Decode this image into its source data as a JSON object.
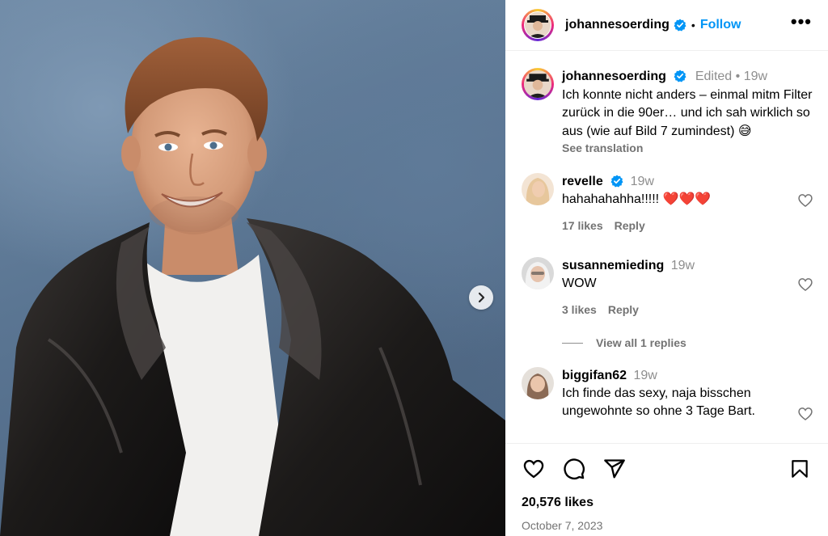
{
  "header": {
    "username": "johannesoerding",
    "follow_label": "Follow",
    "more_label": "•••"
  },
  "caption": {
    "username": "johannesoerding",
    "edited_label": "Edited",
    "time": "19w",
    "text": "Ich konnte nicht anders – einmal mitm Filter zurück in die 90er… und ich sah wirklich so aus (wie auf Bild 7 zumindest) 😅",
    "see_translation": "See translation"
  },
  "comments": [
    {
      "username": "revelle",
      "verified": true,
      "time": "19w",
      "text": "hahahahahha!!!!! ❤️❤️❤️",
      "likes": "17 likes",
      "reply": "Reply"
    },
    {
      "username": "susannemieding",
      "verified": false,
      "time": "19w",
      "text": "WOW",
      "likes": "3 likes",
      "reply": "Reply"
    },
    {
      "username": "biggifan62",
      "verified": false,
      "time": "19w",
      "text": "Ich finde das sexy, naja bisschen ungewohnte so ohne 3 Tage Bart.",
      "likes": "",
      "reply": ""
    }
  ],
  "view_replies": "View all 1 replies",
  "post": {
    "likes": "20,576 likes",
    "date": "October 7, 2023"
  },
  "icons": {
    "like": "heart-icon",
    "comment": "comment-icon",
    "share": "share-icon",
    "save": "bookmark-icon",
    "next": "chevron-right-icon",
    "verified": "verified-badge-icon"
  },
  "colors": {
    "link_blue": "#0095f6",
    "muted_text": "#737373",
    "verified_blue": "#0095f6",
    "heart_red": "#ff3040"
  }
}
